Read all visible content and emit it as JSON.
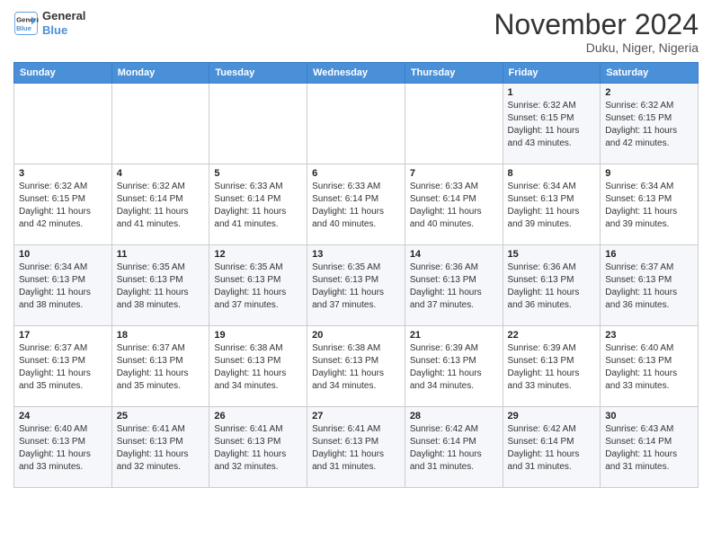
{
  "logo": {
    "line1": "General",
    "line2": "Blue"
  },
  "title": "November 2024",
  "location": "Duku, Niger, Nigeria",
  "weekdays": [
    "Sunday",
    "Monday",
    "Tuesday",
    "Wednesday",
    "Thursday",
    "Friday",
    "Saturday"
  ],
  "weeks": [
    [
      {
        "day": "",
        "info": ""
      },
      {
        "day": "",
        "info": ""
      },
      {
        "day": "",
        "info": ""
      },
      {
        "day": "",
        "info": ""
      },
      {
        "day": "",
        "info": ""
      },
      {
        "day": "1",
        "info": "Sunrise: 6:32 AM\nSunset: 6:15 PM\nDaylight: 11 hours\nand 43 minutes."
      },
      {
        "day": "2",
        "info": "Sunrise: 6:32 AM\nSunset: 6:15 PM\nDaylight: 11 hours\nand 42 minutes."
      }
    ],
    [
      {
        "day": "3",
        "info": "Sunrise: 6:32 AM\nSunset: 6:15 PM\nDaylight: 11 hours\nand 42 minutes."
      },
      {
        "day": "4",
        "info": "Sunrise: 6:32 AM\nSunset: 6:14 PM\nDaylight: 11 hours\nand 41 minutes."
      },
      {
        "day": "5",
        "info": "Sunrise: 6:33 AM\nSunset: 6:14 PM\nDaylight: 11 hours\nand 41 minutes."
      },
      {
        "day": "6",
        "info": "Sunrise: 6:33 AM\nSunset: 6:14 PM\nDaylight: 11 hours\nand 40 minutes."
      },
      {
        "day": "7",
        "info": "Sunrise: 6:33 AM\nSunset: 6:14 PM\nDaylight: 11 hours\nand 40 minutes."
      },
      {
        "day": "8",
        "info": "Sunrise: 6:34 AM\nSunset: 6:13 PM\nDaylight: 11 hours\nand 39 minutes."
      },
      {
        "day": "9",
        "info": "Sunrise: 6:34 AM\nSunset: 6:13 PM\nDaylight: 11 hours\nand 39 minutes."
      }
    ],
    [
      {
        "day": "10",
        "info": "Sunrise: 6:34 AM\nSunset: 6:13 PM\nDaylight: 11 hours\nand 38 minutes."
      },
      {
        "day": "11",
        "info": "Sunrise: 6:35 AM\nSunset: 6:13 PM\nDaylight: 11 hours\nand 38 minutes."
      },
      {
        "day": "12",
        "info": "Sunrise: 6:35 AM\nSunset: 6:13 PM\nDaylight: 11 hours\nand 37 minutes."
      },
      {
        "day": "13",
        "info": "Sunrise: 6:35 AM\nSunset: 6:13 PM\nDaylight: 11 hours\nand 37 minutes."
      },
      {
        "day": "14",
        "info": "Sunrise: 6:36 AM\nSunset: 6:13 PM\nDaylight: 11 hours\nand 37 minutes."
      },
      {
        "day": "15",
        "info": "Sunrise: 6:36 AM\nSunset: 6:13 PM\nDaylight: 11 hours\nand 36 minutes."
      },
      {
        "day": "16",
        "info": "Sunrise: 6:37 AM\nSunset: 6:13 PM\nDaylight: 11 hours\nand 36 minutes."
      }
    ],
    [
      {
        "day": "17",
        "info": "Sunrise: 6:37 AM\nSunset: 6:13 PM\nDaylight: 11 hours\nand 35 minutes."
      },
      {
        "day": "18",
        "info": "Sunrise: 6:37 AM\nSunset: 6:13 PM\nDaylight: 11 hours\nand 35 minutes."
      },
      {
        "day": "19",
        "info": "Sunrise: 6:38 AM\nSunset: 6:13 PM\nDaylight: 11 hours\nand 34 minutes."
      },
      {
        "day": "20",
        "info": "Sunrise: 6:38 AM\nSunset: 6:13 PM\nDaylight: 11 hours\nand 34 minutes."
      },
      {
        "day": "21",
        "info": "Sunrise: 6:39 AM\nSunset: 6:13 PM\nDaylight: 11 hours\nand 34 minutes."
      },
      {
        "day": "22",
        "info": "Sunrise: 6:39 AM\nSunset: 6:13 PM\nDaylight: 11 hours\nand 33 minutes."
      },
      {
        "day": "23",
        "info": "Sunrise: 6:40 AM\nSunset: 6:13 PM\nDaylight: 11 hours\nand 33 minutes."
      }
    ],
    [
      {
        "day": "24",
        "info": "Sunrise: 6:40 AM\nSunset: 6:13 PM\nDaylight: 11 hours\nand 33 minutes."
      },
      {
        "day": "25",
        "info": "Sunrise: 6:41 AM\nSunset: 6:13 PM\nDaylight: 11 hours\nand 32 minutes."
      },
      {
        "day": "26",
        "info": "Sunrise: 6:41 AM\nSunset: 6:13 PM\nDaylight: 11 hours\nand 32 minutes."
      },
      {
        "day": "27",
        "info": "Sunrise: 6:41 AM\nSunset: 6:13 PM\nDaylight: 11 hours\nand 31 minutes."
      },
      {
        "day": "28",
        "info": "Sunrise: 6:42 AM\nSunset: 6:14 PM\nDaylight: 11 hours\nand 31 minutes."
      },
      {
        "day": "29",
        "info": "Sunrise: 6:42 AM\nSunset: 6:14 PM\nDaylight: 11 hours\nand 31 minutes."
      },
      {
        "day": "30",
        "info": "Sunrise: 6:43 AM\nSunset: 6:14 PM\nDaylight: 11 hours\nand 31 minutes."
      }
    ]
  ]
}
